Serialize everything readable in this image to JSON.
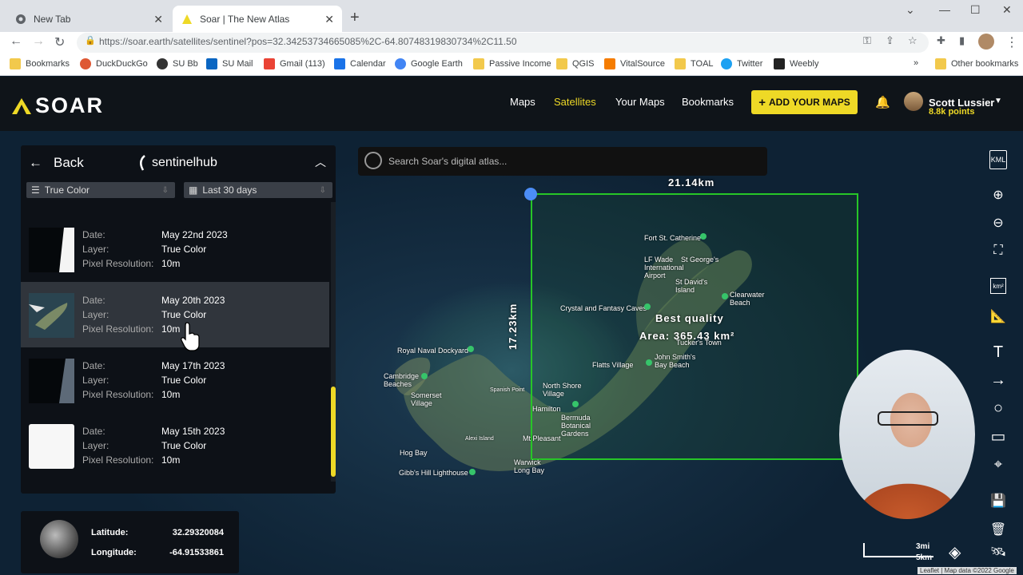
{
  "browser": {
    "tabs": [
      {
        "title": "New Tab"
      },
      {
        "title": "Soar | The New Atlas"
      }
    ],
    "url": "https://soar.earth/satellites/sentinel?pos=32.34253734665085%2C-64.80748319830734%2C11.50",
    "bookmarks": [
      "Bookmarks",
      "DuckDuckGo",
      "SU Bb",
      "SU Mail",
      "Gmail (113)",
      "Calendar",
      "Google Earth",
      "Passive Income",
      "QGIS",
      "VitalSource",
      "TOAL",
      "Twitter",
      "Weebly"
    ],
    "overflow": "»",
    "other_bookmarks": "Other bookmarks"
  },
  "header": {
    "logo": "SOAR",
    "nav": [
      "Maps",
      "Satellites",
      "Your Maps",
      "Bookmarks"
    ],
    "active_nav": "Satellites",
    "add_button": "ADD YOUR MAPS",
    "user_name": "Scott Lussier",
    "user_points": "8.8k points",
    "accent": "#eed926"
  },
  "search": {
    "placeholder": "Search Soar's digital atlas..."
  },
  "panel": {
    "back": "Back",
    "provider": "sentinelhub",
    "filter_layer": "True Color",
    "filter_time": "Last 30 days",
    "labels": {
      "date": "Date:",
      "layer": "Layer:",
      "resolution": "Pixel Resolution:"
    },
    "items": [
      {
        "date": "May 22nd 2023",
        "layer": "True Color",
        "resolution": "10m",
        "selected": false
      },
      {
        "date": "May 20th 2023",
        "layer": "True Color",
        "resolution": "10m",
        "selected": true
      },
      {
        "date": "May 17th 2023",
        "layer": "True Color",
        "resolution": "10m",
        "selected": false
      },
      {
        "date": "May 15th 2023",
        "layer": "True Color",
        "resolution": "10m",
        "selected": false
      }
    ]
  },
  "map": {
    "width_measure": "21.14km",
    "height_measure": "17.23km",
    "quality": "Best quality",
    "area": "Area: 365.43 km²",
    "places": [
      "Fort St. Catherine",
      "LF Wade International Airport",
      "St George's",
      "St David's Island",
      "Clearwater Beach",
      "Tucker's Town",
      "Crystal and Fantasy Caves",
      "John Smith's Bay Beach",
      "Flatts Village",
      "Royal Naval Dockyard",
      "Cambridge Beaches",
      "Somerset Village",
      "North Shore Village",
      "Hamilton",
      "Bermuda Botanical Gardens",
      "Spanish Point",
      "Alexi Island",
      "Mt Pleasant",
      "Hog Bay",
      "Gibb's Hill Lighthouse",
      "Warwick Long Bay"
    ],
    "scale_top": "3mi",
    "scale_bottom": "5km",
    "attribution": "Leaflet | Map data ©2022 Google"
  },
  "coords": {
    "lat_label": "Latitude:",
    "lat": "32.29320084",
    "lon_label": "Longitude:",
    "lon": "-64.91533861"
  },
  "tools": {
    "kml": "KML",
    "km2": "km²"
  }
}
